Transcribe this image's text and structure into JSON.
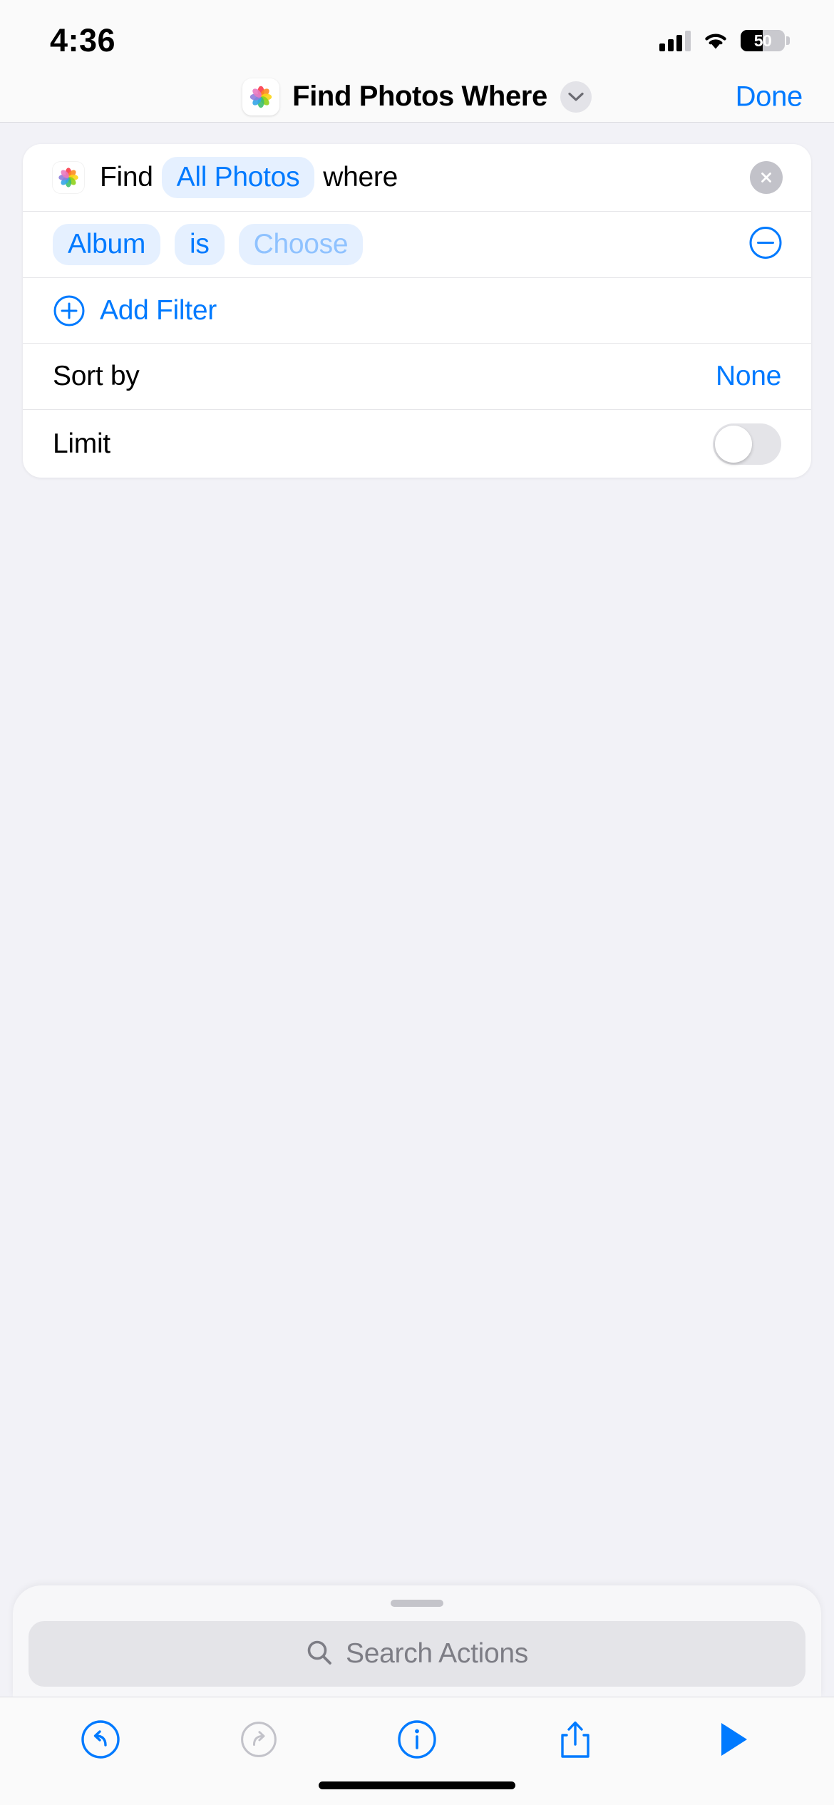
{
  "status_bar": {
    "time": "4:36",
    "signal_icon": "cellular-signal-icon",
    "wifi_icon": "wifi-icon",
    "battery_icon": "battery-icon",
    "battery_level": "50",
    "battery_percent": 50
  },
  "nav_bar": {
    "app_icon": "photos-app-icon",
    "title": "Find Photos Where",
    "chevron_icon": "chevron-down-icon",
    "done_label": "Done"
  },
  "action_card": {
    "find_row": {
      "icon": "photos-app-icon",
      "prefix": "Find",
      "source": "All Photos",
      "suffix": "where",
      "remove_icon": "close-circle-icon"
    },
    "filter_row": {
      "property": "Album",
      "operator": "is",
      "value_placeholder": "Choose",
      "remove_icon": "minus-circle-icon"
    },
    "add_filter": {
      "icon": "plus-circle-icon",
      "label": "Add Filter"
    },
    "sort_by": {
      "label": "Sort by",
      "value": "None"
    },
    "limit": {
      "label": "Limit",
      "enabled": false
    }
  },
  "search_sheet": {
    "grabber": "sheet-grabber",
    "search_icon": "search-icon",
    "placeholder": "Search Actions"
  },
  "toolbar": {
    "items": [
      {
        "name": "undo-button",
        "icon": "undo-icon",
        "enabled": true
      },
      {
        "name": "redo-button",
        "icon": "redo-icon",
        "enabled": false
      },
      {
        "name": "info-button",
        "icon": "info-circle-icon",
        "enabled": true
      },
      {
        "name": "share-button",
        "icon": "share-icon",
        "enabled": true
      },
      {
        "name": "run-button",
        "icon": "play-icon",
        "enabled": true
      }
    ]
  },
  "colors": {
    "accent_blue": "#007aff",
    "pill_bg": "#e5f0ff",
    "placeholder_blue": "#8fc2ff",
    "page_bg": "#f2f2f7",
    "card_bg": "#ffffff",
    "disabled_gray": "#c2c2c9"
  }
}
